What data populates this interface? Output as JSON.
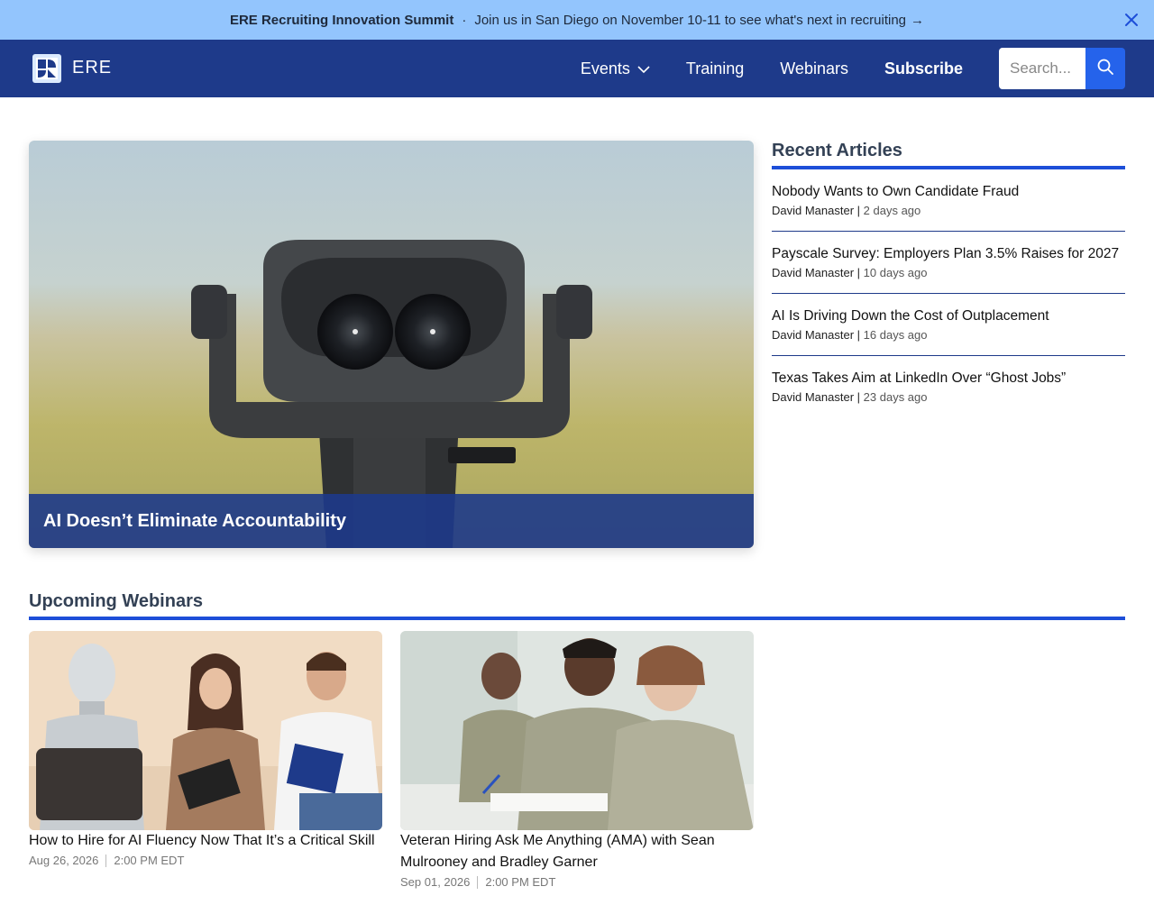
{
  "announcement": {
    "title": "ERE Recruiting Innovation Summit",
    "separator": "·",
    "message": "Join us in San Diego on November 10-11 to see what's next in recruiting",
    "arrow": "→",
    "close_icon": "close-icon"
  },
  "nav": {
    "brand": "ERE",
    "logo_icon": "ere-logo-icon",
    "links": [
      {
        "label": "Events",
        "has_dropdown": true
      },
      {
        "label": "Training"
      },
      {
        "label": "Webinars"
      },
      {
        "label": "Subscribe"
      }
    ],
    "search_placeholder": "Search...",
    "search_icon": "search-icon"
  },
  "hero": {
    "title": "AI Doesn’t Eliminate Accountability",
    "image": "binoculars-photo"
  },
  "recent": {
    "heading": "Recent Articles",
    "articles": [
      {
        "title": "Nobody Wants to Own Candidate Fraud",
        "author": "David Manaster",
        "sep": " | ",
        "date": "2 days ago"
      },
      {
        "title": "Payscale Survey: Employers Plan 3.5% Raises for 2027",
        "author": "David Manaster",
        "sep": " | ",
        "date": "10 days ago"
      },
      {
        "title": "AI Is Driving Down the Cost of Outplacement",
        "author": "David Manaster",
        "sep": " | ",
        "date": "16 days ago"
      },
      {
        "title": "Texas Takes Aim at LinkedIn Over “Ghost Jobs”",
        "author": "David Manaster",
        "sep": " | ",
        "date": "23 days ago"
      }
    ]
  },
  "webinars": {
    "heading": "Upcoming Webinars",
    "items": [
      {
        "title": "How to Hire for AI Fluency Now That It’s a Critical Skill",
        "date": "Aug 26, 2026",
        "time": "2:00 PM EDT"
      },
      {
        "title": "Veteran Hiring Ask Me Anything (AMA) with Sean Mulrooney and Bradley Garner",
        "date": "Sep 01, 2026",
        "time": "2:00 PM EDT"
      }
    ]
  },
  "colors": {
    "announce_bg": "#93c5fd",
    "nav_bg": "#1e3a8a",
    "accent": "#1d4ed8",
    "search_button": "#2563eb"
  }
}
